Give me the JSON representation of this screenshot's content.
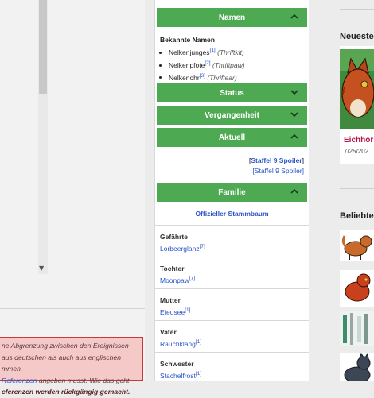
{
  "warning": {
    "line1": "ne Abgrenzung zwischen den Ereignissen",
    "line2": "aus deutschen als auch aus englischen",
    "line3": "mmen.",
    "line4_link": "Referenzen",
    "line4_rest": " angeben musst. Wie das geht",
    "line5": "eferenzen werden rückgängig gemacht."
  },
  "infobox": {
    "sections": {
      "namen": "Namen",
      "status": "Status",
      "vergangenheit": "Vergangenheit",
      "aktuell": "Aktuell",
      "familie": "Familie"
    },
    "names": {
      "header": "Bekannte Namen",
      "items": [
        {
          "name": "Nelkenjunges",
          "ref": "[1]",
          "en": "(Thriftkit)"
        },
        {
          "name": "Nelkenpfote",
          "ref": "[2]",
          "en": "(Thriftpaw)"
        },
        {
          "name": "Nelkenohr",
          "ref": "[3]",
          "en": "(Thriftear)"
        }
      ]
    },
    "spoiler": {
      "bracket_open": "[",
      "label": "Staffel 9 Spoiler",
      "bracket_close": "]",
      "sub": "[Staffel 9 Spoiler]"
    },
    "stammbaum": "Offizieller Stammbaum",
    "family": [
      {
        "label": "Gefährte",
        "value": "Lorbeerglanz",
        "ref": "[7]"
      },
      {
        "label": "Tochter",
        "value": "Moonpaw",
        "ref": "[7]"
      },
      {
        "label": "Mutter",
        "value": "Efeusee",
        "ref": "[1]"
      },
      {
        "label": "Vater",
        "value": "Rauchklang",
        "ref": "[1]"
      },
      {
        "label": "Schwester",
        "value": "Stachelfrost",
        "ref": "[1]"
      }
    ]
  },
  "right": {
    "newest_title": "Neueste",
    "article_title": "Eichhor",
    "article_date": "7/25/202",
    "popular_title": "Beliebte"
  },
  "colors": {
    "section_green": "#4daa52",
    "link_blue": "#2a55c9",
    "warning_bg": "#f6c9c9",
    "warning_border": "#c6393a"
  }
}
